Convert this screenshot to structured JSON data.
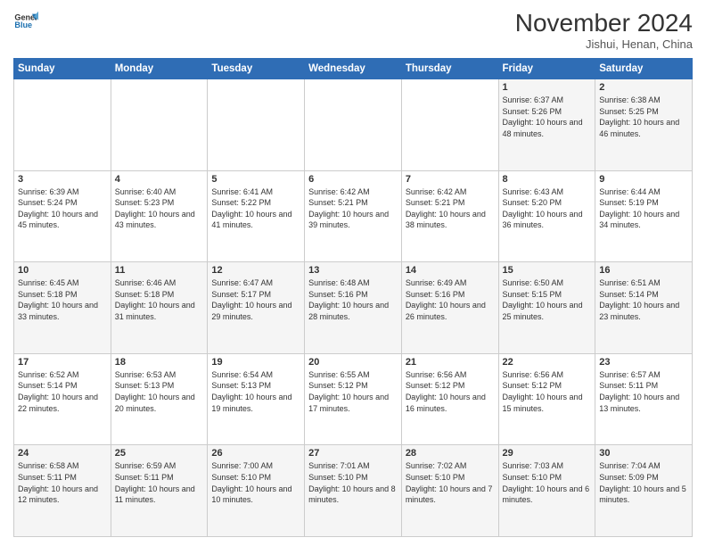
{
  "logo": {
    "line1": "General",
    "line2": "Blue"
  },
  "title": "November 2024",
  "location": "Jishui, Henan, China",
  "weekdays": [
    "Sunday",
    "Monday",
    "Tuesday",
    "Wednesday",
    "Thursday",
    "Friday",
    "Saturday"
  ],
  "weeks": [
    [
      {
        "day": "",
        "info": ""
      },
      {
        "day": "",
        "info": ""
      },
      {
        "day": "",
        "info": ""
      },
      {
        "day": "",
        "info": ""
      },
      {
        "day": "",
        "info": ""
      },
      {
        "day": "1",
        "info": "Sunrise: 6:37 AM\nSunset: 5:26 PM\nDaylight: 10 hours and 48 minutes."
      },
      {
        "day": "2",
        "info": "Sunrise: 6:38 AM\nSunset: 5:25 PM\nDaylight: 10 hours and 46 minutes."
      }
    ],
    [
      {
        "day": "3",
        "info": "Sunrise: 6:39 AM\nSunset: 5:24 PM\nDaylight: 10 hours and 45 minutes."
      },
      {
        "day": "4",
        "info": "Sunrise: 6:40 AM\nSunset: 5:23 PM\nDaylight: 10 hours and 43 minutes."
      },
      {
        "day": "5",
        "info": "Sunrise: 6:41 AM\nSunset: 5:22 PM\nDaylight: 10 hours and 41 minutes."
      },
      {
        "day": "6",
        "info": "Sunrise: 6:42 AM\nSunset: 5:21 PM\nDaylight: 10 hours and 39 minutes."
      },
      {
        "day": "7",
        "info": "Sunrise: 6:42 AM\nSunset: 5:21 PM\nDaylight: 10 hours and 38 minutes."
      },
      {
        "day": "8",
        "info": "Sunrise: 6:43 AM\nSunset: 5:20 PM\nDaylight: 10 hours and 36 minutes."
      },
      {
        "day": "9",
        "info": "Sunrise: 6:44 AM\nSunset: 5:19 PM\nDaylight: 10 hours and 34 minutes."
      }
    ],
    [
      {
        "day": "10",
        "info": "Sunrise: 6:45 AM\nSunset: 5:18 PM\nDaylight: 10 hours and 33 minutes."
      },
      {
        "day": "11",
        "info": "Sunrise: 6:46 AM\nSunset: 5:18 PM\nDaylight: 10 hours and 31 minutes."
      },
      {
        "day": "12",
        "info": "Sunrise: 6:47 AM\nSunset: 5:17 PM\nDaylight: 10 hours and 29 minutes."
      },
      {
        "day": "13",
        "info": "Sunrise: 6:48 AM\nSunset: 5:16 PM\nDaylight: 10 hours and 28 minutes."
      },
      {
        "day": "14",
        "info": "Sunrise: 6:49 AM\nSunset: 5:16 PM\nDaylight: 10 hours and 26 minutes."
      },
      {
        "day": "15",
        "info": "Sunrise: 6:50 AM\nSunset: 5:15 PM\nDaylight: 10 hours and 25 minutes."
      },
      {
        "day": "16",
        "info": "Sunrise: 6:51 AM\nSunset: 5:14 PM\nDaylight: 10 hours and 23 minutes."
      }
    ],
    [
      {
        "day": "17",
        "info": "Sunrise: 6:52 AM\nSunset: 5:14 PM\nDaylight: 10 hours and 22 minutes."
      },
      {
        "day": "18",
        "info": "Sunrise: 6:53 AM\nSunset: 5:13 PM\nDaylight: 10 hours and 20 minutes."
      },
      {
        "day": "19",
        "info": "Sunrise: 6:54 AM\nSunset: 5:13 PM\nDaylight: 10 hours and 19 minutes."
      },
      {
        "day": "20",
        "info": "Sunrise: 6:55 AM\nSunset: 5:12 PM\nDaylight: 10 hours and 17 minutes."
      },
      {
        "day": "21",
        "info": "Sunrise: 6:56 AM\nSunset: 5:12 PM\nDaylight: 10 hours and 16 minutes."
      },
      {
        "day": "22",
        "info": "Sunrise: 6:56 AM\nSunset: 5:12 PM\nDaylight: 10 hours and 15 minutes."
      },
      {
        "day": "23",
        "info": "Sunrise: 6:57 AM\nSunset: 5:11 PM\nDaylight: 10 hours and 13 minutes."
      }
    ],
    [
      {
        "day": "24",
        "info": "Sunrise: 6:58 AM\nSunset: 5:11 PM\nDaylight: 10 hours and 12 minutes."
      },
      {
        "day": "25",
        "info": "Sunrise: 6:59 AM\nSunset: 5:11 PM\nDaylight: 10 hours and 11 minutes."
      },
      {
        "day": "26",
        "info": "Sunrise: 7:00 AM\nSunset: 5:10 PM\nDaylight: 10 hours and 10 minutes."
      },
      {
        "day": "27",
        "info": "Sunrise: 7:01 AM\nSunset: 5:10 PM\nDaylight: 10 hours and 8 minutes."
      },
      {
        "day": "28",
        "info": "Sunrise: 7:02 AM\nSunset: 5:10 PM\nDaylight: 10 hours and 7 minutes."
      },
      {
        "day": "29",
        "info": "Sunrise: 7:03 AM\nSunset: 5:10 PM\nDaylight: 10 hours and 6 minutes."
      },
      {
        "day": "30",
        "info": "Sunrise: 7:04 AM\nSunset: 5:09 PM\nDaylight: 10 hours and 5 minutes."
      }
    ]
  ]
}
